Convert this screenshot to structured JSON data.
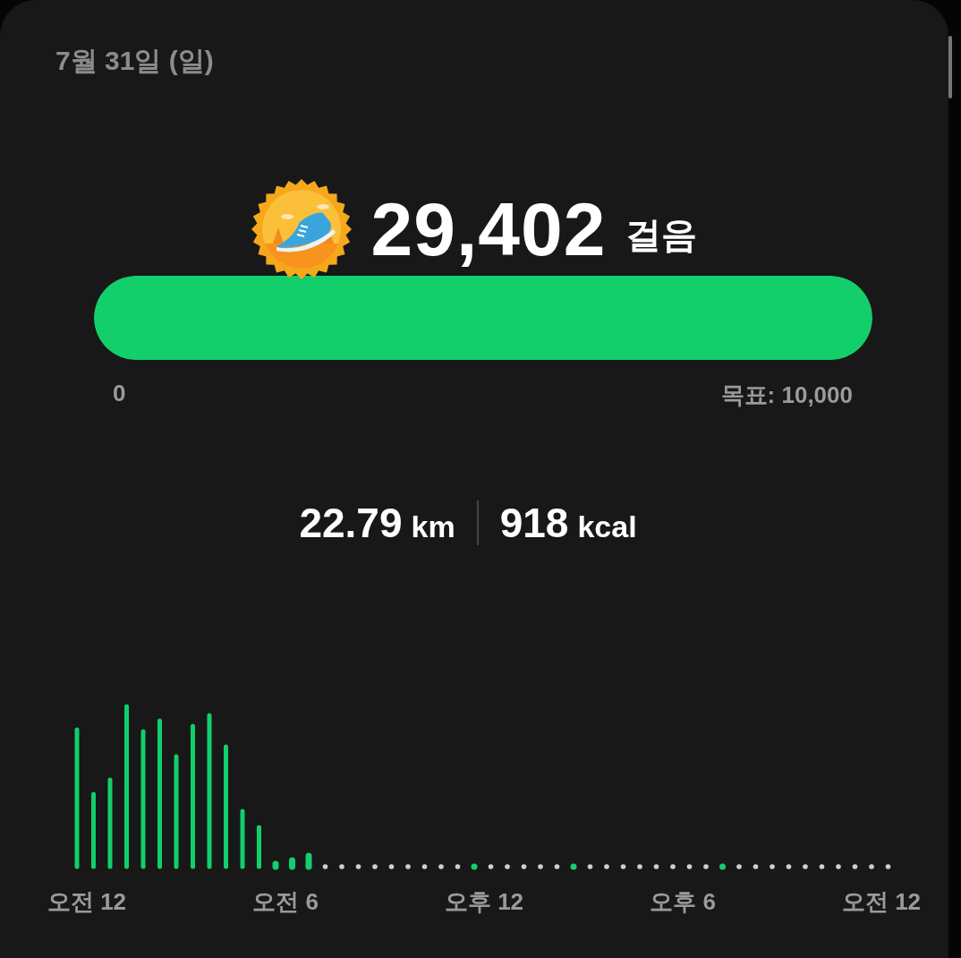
{
  "date": "7월 31일 (일)",
  "steps": {
    "value": "29,402",
    "unit": "걸음"
  },
  "goal_bar": {
    "level": 1,
    "start_label": "0",
    "goal_label": "목표: 10,000"
  },
  "stats": [
    {
      "value": "22.79",
      "unit": "km"
    },
    {
      "value": "918",
      "unit": "kcal"
    }
  ],
  "chart": {
    "x_labels": [
      "오전 12",
      "오전 6",
      "오후 12",
      "오후 6",
      "오전 12"
    ]
  }
}
